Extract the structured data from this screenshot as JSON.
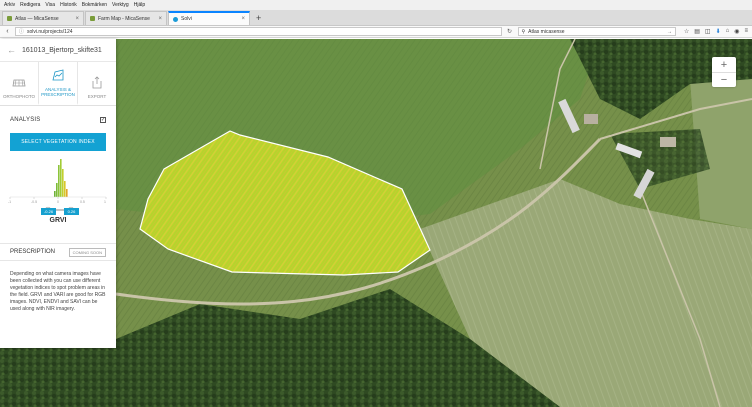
{
  "browser": {
    "menu": [
      "Arkiv",
      "Redigera",
      "Visa",
      "Historik",
      "Bokmärken",
      "Verktyg",
      "Hjälp"
    ],
    "tabs": [
      {
        "title": "Atlas — MicaSense"
      },
      {
        "title": "Farm Map - MicaSense"
      },
      {
        "title": "Solvi"
      }
    ],
    "new_tab": "+",
    "url": "solvi.nu/projects/124",
    "search_value": "Atlas micasense"
  },
  "map": {
    "zoom_in": "+",
    "zoom_out": "−"
  },
  "panel": {
    "back_icon": "arrow-left-icon",
    "project_title": "161013_Bjertorp_skifte31",
    "tabs": [
      {
        "label": "ORTHOPHOTO",
        "icon": "orthophoto-icon",
        "active": false
      },
      {
        "label": "ANALYSIS & PRESCRIPTION",
        "icon": "analysis-icon",
        "active": true
      },
      {
        "label": "EXPORT",
        "icon": "export-icon",
        "active": false
      }
    ],
    "analysis_label": "ANALYSIS",
    "analysis_checked": true,
    "select_vi_button": "SELECT VEGETATION INDEX",
    "histogram": {
      "ticks": [
        "-1",
        "-0.5",
        "0",
        "0.5",
        "1"
      ],
      "range_min_label": "-0.26",
      "range_max_label": "0.26",
      "range": [
        -0.26,
        0.26
      ],
      "index_name": "GRVI"
    },
    "prescription_label": "PRESCRIPTION",
    "coming_soon": "COMING SOON",
    "description": "Depending on what camera images have been collected with you can use different vegetation indices to spot problem areas in the field. GRVI and VARI are good for RGB images. NDVI, ENDVI and SAVI can be used along with NIR imagery."
  },
  "colors": {
    "accent": "#13a2d3",
    "tab_active": "#1f97c6",
    "field_fill": "#b7d62a"
  }
}
